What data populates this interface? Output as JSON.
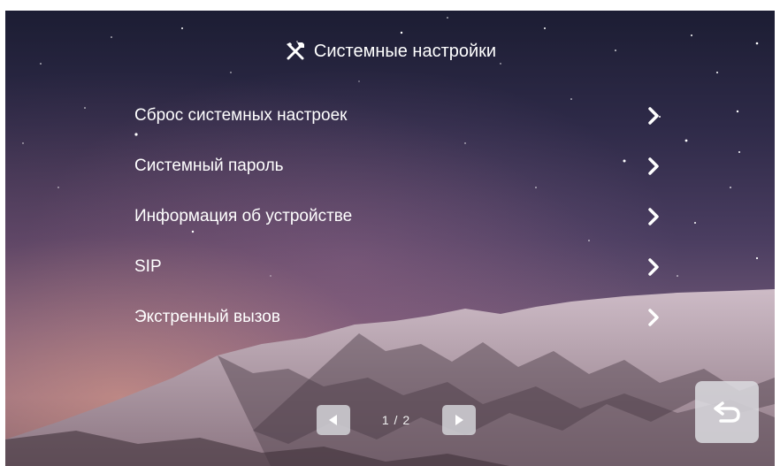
{
  "header": {
    "title": "Системные настройки",
    "icon": "tools-icon"
  },
  "menu": {
    "items": [
      {
        "label": "Сброс системных настроек",
        "icon": "chevron-right-icon"
      },
      {
        "label": "Системный пароль",
        "icon": "chevron-right-icon"
      },
      {
        "label": "Информация об устройстве",
        "icon": "chevron-right-icon"
      },
      {
        "label": "SIP",
        "icon": "chevron-right-icon"
      },
      {
        "label": "Экстренный вызов",
        "icon": "chevron-right-icon"
      }
    ]
  },
  "pager": {
    "text": "1 / 2",
    "prev_icon": "triangle-left-icon",
    "next_icon": "triangle-right-icon"
  },
  "back_button": {
    "icon": "return-arrow-icon"
  },
  "colors": {
    "text": "#ffffff",
    "button_bg": "#d7d7dc",
    "button_icon": "#ffffff"
  }
}
